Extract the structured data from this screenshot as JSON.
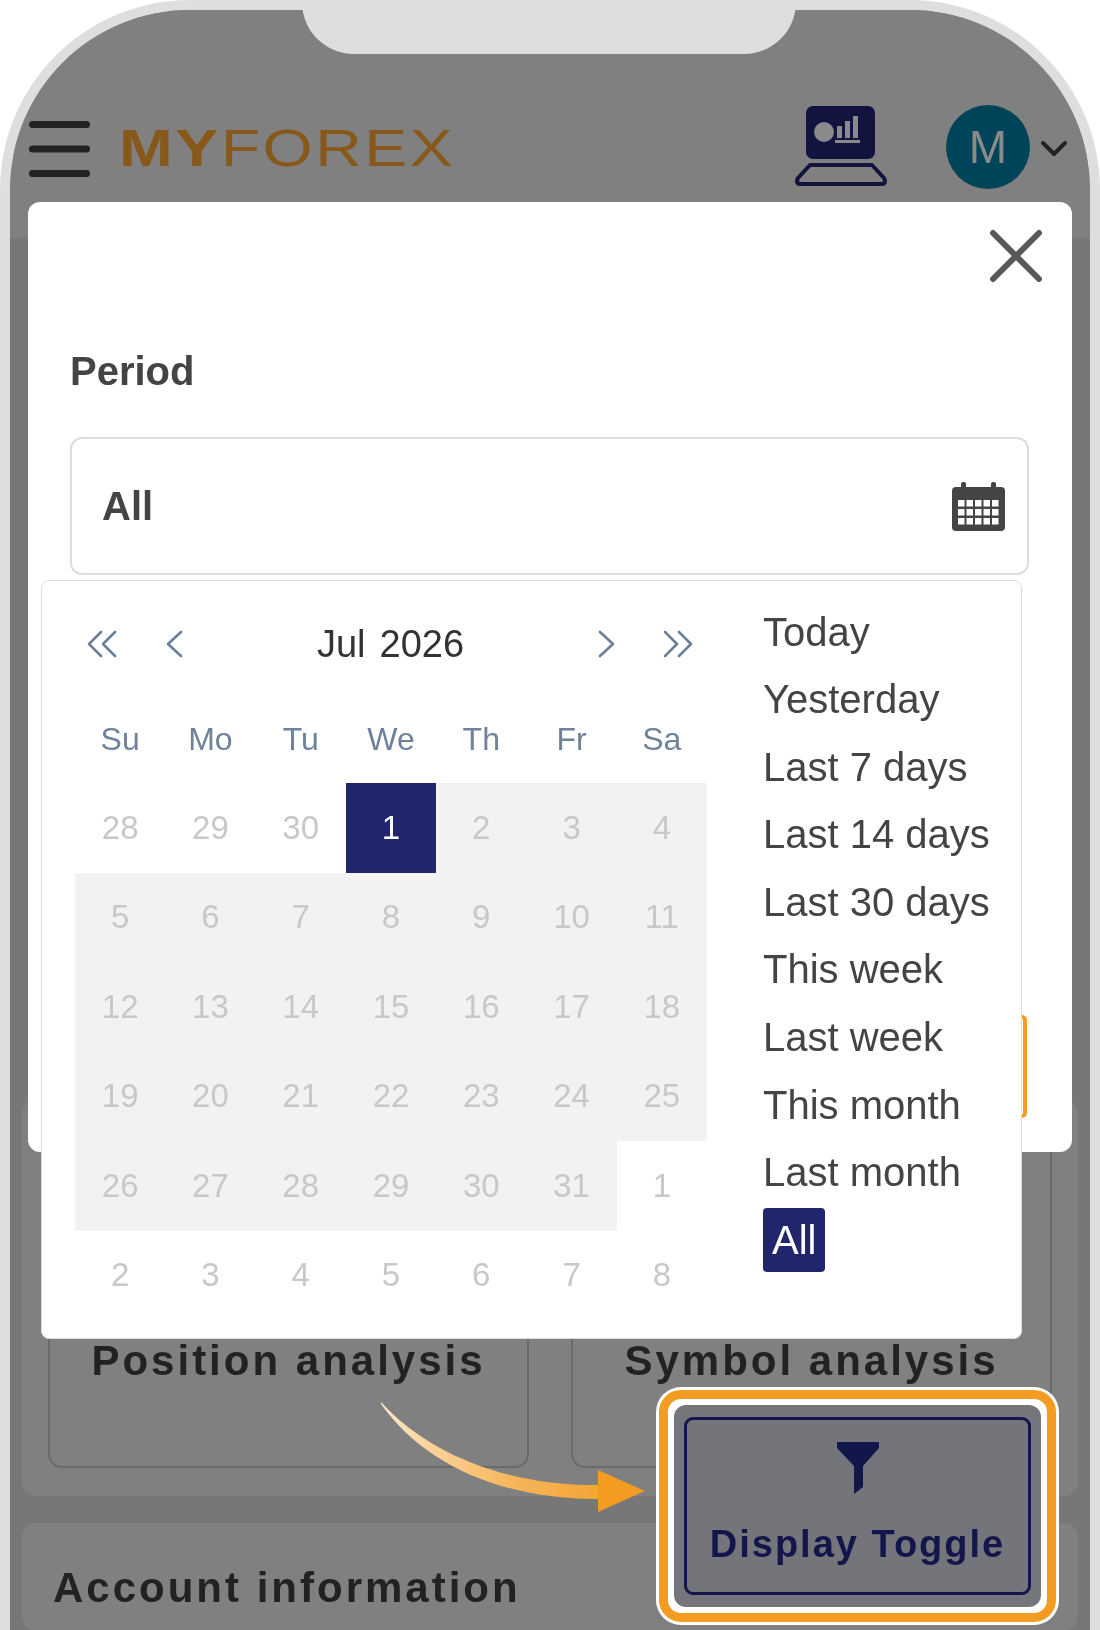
{
  "header": {
    "logo": "**MY**FOREX",
    "avatar_initial": "M"
  },
  "modal": {
    "field_label": "Period",
    "field_value": "All",
    "datepicker": {
      "month": "Jul",
      "year": "2026",
      "weekdays": [
        "Su",
        "Mo",
        "Tu",
        "We",
        "Th",
        "Fr",
        "Sa"
      ],
      "weeks": [
        [
          {
            "label": "28",
            "selected": false,
            "in_range": false
          },
          {
            "label": "29",
            "selected": false,
            "in_range": false
          },
          {
            "label": "30",
            "selected": false,
            "in_range": false
          },
          {
            "label": "1",
            "selected": true,
            "in_range": false
          },
          {
            "label": "2",
            "selected": false,
            "in_range": true
          },
          {
            "label": "3",
            "selected": false,
            "in_range": true
          },
          {
            "label": "4",
            "selected": false,
            "in_range": true
          }
        ],
        [
          {
            "label": "5",
            "selected": false,
            "in_range": true
          },
          {
            "label": "6",
            "selected": false,
            "in_range": true
          },
          {
            "label": "7",
            "selected": false,
            "in_range": true
          },
          {
            "label": "8",
            "selected": false,
            "in_range": true
          },
          {
            "label": "9",
            "selected": false,
            "in_range": true
          },
          {
            "label": "10",
            "selected": false,
            "in_range": true
          },
          {
            "label": "11",
            "selected": false,
            "in_range": true
          }
        ],
        [
          {
            "label": "12",
            "selected": false,
            "in_range": true
          },
          {
            "label": "13",
            "selected": false,
            "in_range": true
          },
          {
            "label": "14",
            "selected": false,
            "in_range": true
          },
          {
            "label": "15",
            "selected": false,
            "in_range": true
          },
          {
            "label": "16",
            "selected": false,
            "in_range": true
          },
          {
            "label": "17",
            "selected": false,
            "in_range": true
          },
          {
            "label": "18",
            "selected": false,
            "in_range": true
          }
        ],
        [
          {
            "label": "19",
            "selected": false,
            "in_range": true
          },
          {
            "label": "20",
            "selected": false,
            "in_range": true
          },
          {
            "label": "21",
            "selected": false,
            "in_range": true
          },
          {
            "label": "22",
            "selected": false,
            "in_range": true
          },
          {
            "label": "23",
            "selected": false,
            "in_range": true
          },
          {
            "label": "24",
            "selected": false,
            "in_range": true
          },
          {
            "label": "25",
            "selected": false,
            "in_range": true
          }
        ],
        [
          {
            "label": "26",
            "selected": false,
            "in_range": true
          },
          {
            "label": "27",
            "selected": false,
            "in_range": true
          },
          {
            "label": "28",
            "selected": false,
            "in_range": true
          },
          {
            "label": "29",
            "selected": false,
            "in_range": true
          },
          {
            "label": "30",
            "selected": false,
            "in_range": true
          },
          {
            "label": "31",
            "selected": false,
            "in_range": true
          },
          {
            "label": "1",
            "selected": false,
            "in_range": false
          }
        ],
        [
          {
            "label": "2",
            "selected": false,
            "in_range": false
          },
          {
            "label": "3",
            "selected": false,
            "in_range": false
          },
          {
            "label": "4",
            "selected": false,
            "in_range": false
          },
          {
            "label": "5",
            "selected": false,
            "in_range": false
          },
          {
            "label": "6",
            "selected": false,
            "in_range": false
          },
          {
            "label": "7",
            "selected": false,
            "in_range": false
          },
          {
            "label": "8",
            "selected": false,
            "in_range": false
          }
        ]
      ],
      "presets": [
        {
          "label": "Today",
          "selected": false
        },
        {
          "label": "Yesterday",
          "selected": false
        },
        {
          "label": "Last 7 days",
          "selected": false
        },
        {
          "label": "Last 14 days",
          "selected": false
        },
        {
          "label": "Last 30 days",
          "selected": false
        },
        {
          "label": "This week",
          "selected": false
        },
        {
          "label": "Last week",
          "selected": false
        },
        {
          "label": "This month",
          "selected": false
        },
        {
          "label": "Last month",
          "selected": false
        },
        {
          "label": "All",
          "selected": true
        }
      ]
    }
  },
  "background": {
    "cards": [
      {
        "title": "Position analysis"
      },
      {
        "title": "Symbol analysis"
      }
    ],
    "section_title": "Account information"
  },
  "callout": {
    "button_label": "Display Toggle"
  }
}
